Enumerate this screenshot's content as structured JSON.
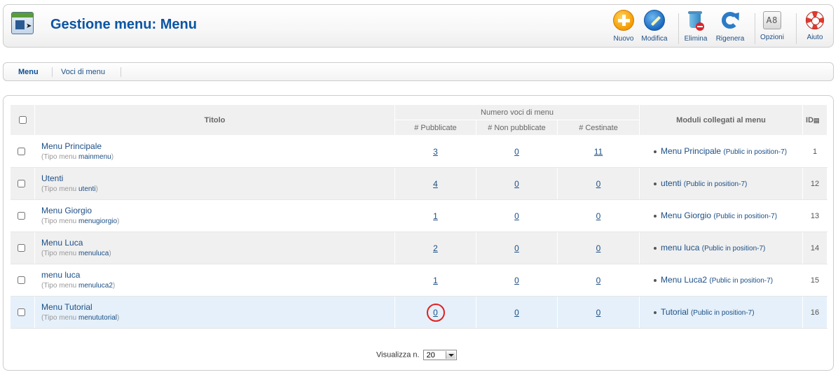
{
  "header": {
    "title": "Gestione menu: Menu",
    "toolbar": [
      {
        "key": "nuovo",
        "label": "Nuovo",
        "icon": "add-icon"
      },
      {
        "key": "modifica",
        "label": "Modifica",
        "icon": "edit-icon"
      },
      {
        "key": "elimina",
        "label": "Elimina",
        "icon": "trash-icon"
      },
      {
        "key": "rigenera",
        "label": "Rigenera",
        "icon": "refresh-icon"
      },
      {
        "key": "opzioni",
        "label": "Opzioni",
        "icon": "options-icon"
      },
      {
        "key": "aiuto",
        "label": "Aiuto",
        "icon": "help-icon"
      }
    ]
  },
  "submenu": {
    "items": [
      "Menu",
      "Voci di menu"
    ],
    "active": "Menu"
  },
  "table": {
    "columns": {
      "title": "Titolo",
      "group": "Numero voci di menu",
      "published": "# Pubblicate",
      "unpublished": "# Non pubblicate",
      "trashed": "# Cestinate",
      "modules": "Moduli collegati al menu",
      "id": "ID"
    },
    "type_prefix": "Tipo menu",
    "rows": [
      {
        "title": "Menu Principale",
        "menutype": "mainmenu",
        "published": "3",
        "unpublished": "0",
        "trashed": "11",
        "module": "Menu Principale",
        "module_pos": "(Public in position-7)",
        "id": "1"
      },
      {
        "title": "Utenti",
        "menutype": "utenti",
        "published": "4",
        "unpublished": "0",
        "trashed": "0",
        "module": "utenti",
        "module_pos": "(Public in position-7)",
        "id": "12"
      },
      {
        "title": "Menu Giorgio",
        "menutype": "menugiorgio",
        "published": "1",
        "unpublished": "0",
        "trashed": "0",
        "module": "Menu Giorgio",
        "module_pos": "(Public in position-7)",
        "id": "13"
      },
      {
        "title": "Menu Luca",
        "menutype": "menuluca",
        "published": "2",
        "unpublished": "0",
        "trashed": "0",
        "module": "menu luca",
        "module_pos": "(Public in position-7)",
        "id": "14"
      },
      {
        "title": "menu luca",
        "menutype": "menuluca2",
        "published": "1",
        "unpublished": "0",
        "trashed": "0",
        "module": "Menu Luca2",
        "module_pos": "(Public in position-7)",
        "id": "15"
      },
      {
        "title": "Menu Tutorial",
        "menutype": "menututorial",
        "published": "0",
        "unpublished": "0",
        "trashed": "0",
        "module": "Tutorial",
        "module_pos": "(Public in position-7)",
        "id": "16"
      }
    ]
  },
  "pagination": {
    "label": "Visualizza n.",
    "value": "20"
  },
  "colors": {
    "title": "#0b55a4",
    "link": "#1c4f85",
    "highlight_row": "#e5f0fa",
    "annotation_circle": "#e02020"
  }
}
